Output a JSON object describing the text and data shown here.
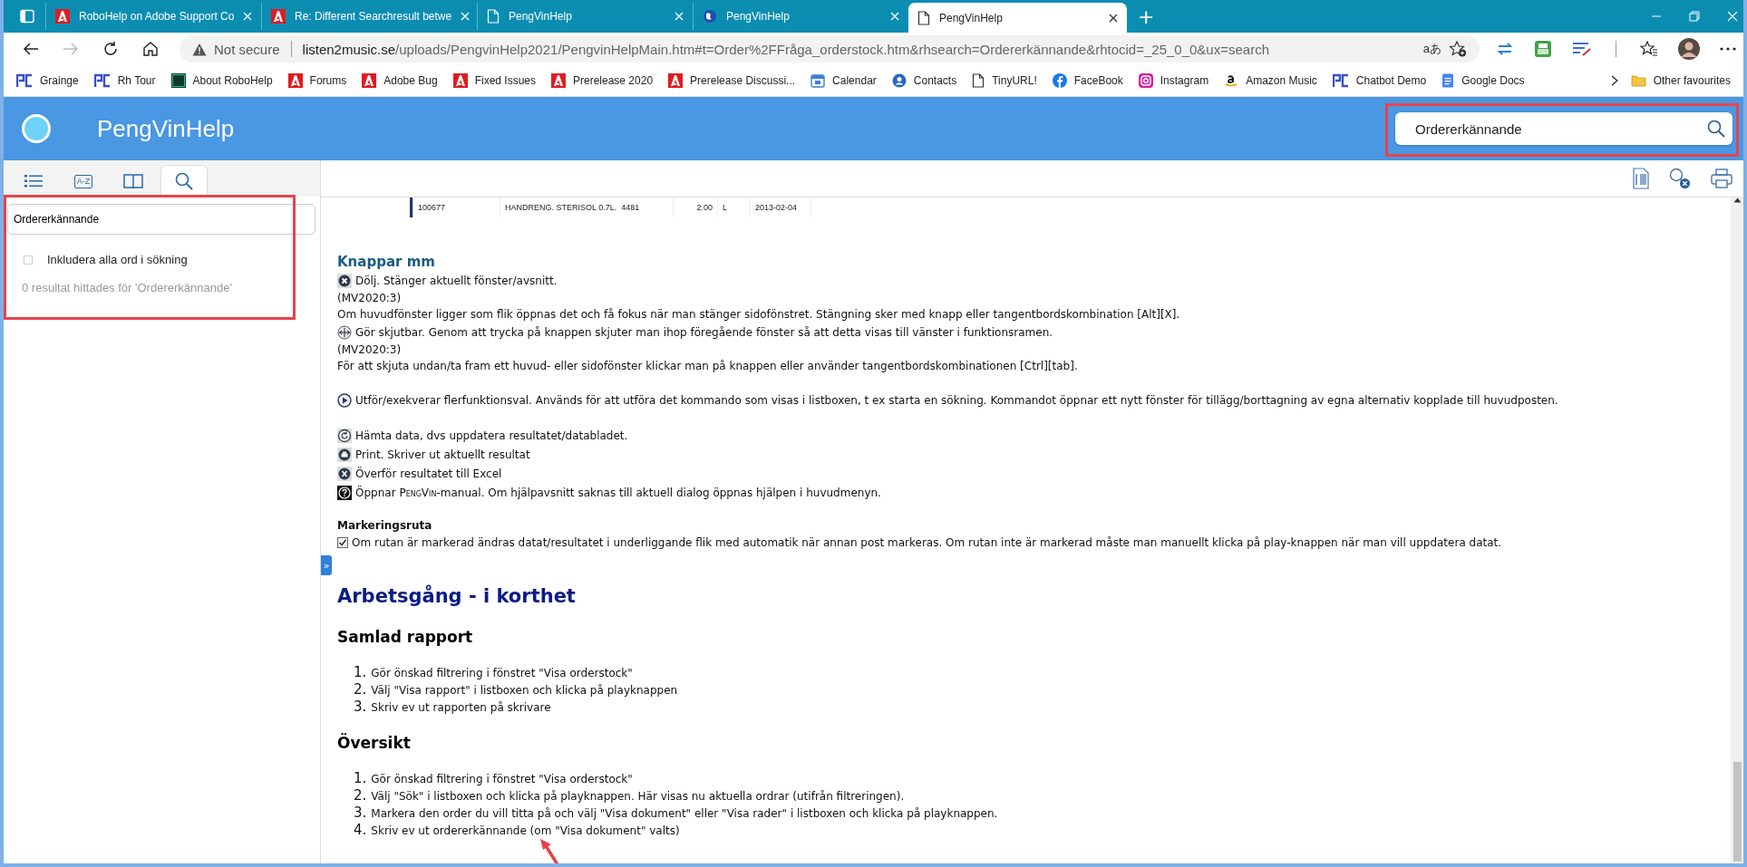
{
  "browser": {
    "tabs": [
      {
        "title": "RoboHelp on Adobe Support Co",
        "kind": "adobe",
        "selected": false
      },
      {
        "title": "Re: Different Searchresult betwe",
        "kind": "adobe",
        "selected": false
      },
      {
        "title": "PengVinHelp",
        "kind": "page",
        "selected": false
      },
      {
        "title": "PengVinHelp",
        "kind": "globe",
        "selected": false
      },
      {
        "title": "PengVinHelp",
        "kind": "page",
        "selected": true
      }
    ],
    "new_tab": "+",
    "address": {
      "security": "Not secure",
      "host": "listen2music.se",
      "path": "/uploads/PengvinHelp2021/PengvinHelpMain.htm#t=Order%2FFråga_orderstock.htm&rhsearch=Ordererkännande&rhtocid=_25_0_0&ux=search",
      "read_aloud": "aあ"
    },
    "bookmarks": [
      {
        "label": "Grainge",
        "kind": "pc"
      },
      {
        "label": "Rh Tour",
        "kind": "pc"
      },
      {
        "label": "About RoboHelp",
        "kind": "rh"
      },
      {
        "label": "Forums",
        "kind": "adobe"
      },
      {
        "label": "Adobe Bug",
        "kind": "adobe"
      },
      {
        "label": "Fixed Issues",
        "kind": "adobe"
      },
      {
        "label": "Prerelease 2020",
        "kind": "adobe"
      },
      {
        "label": "Prerelease Discussi...",
        "kind": "adobe"
      },
      {
        "label": "Calendar",
        "kind": "calendar"
      },
      {
        "label": "Contacts",
        "kind": "contacts"
      },
      {
        "label": "TinyURL!",
        "kind": "page"
      },
      {
        "label": "FaceBook",
        "kind": "facebook"
      },
      {
        "label": "Instagram",
        "kind": "instagram"
      },
      {
        "label": "Amazon Music",
        "kind": "amazon"
      },
      {
        "label": "Chatbot Demo",
        "kind": "pc"
      },
      {
        "label": "Google Docs",
        "kind": "docs"
      }
    ],
    "other_favourites": "Other favourites"
  },
  "header": {
    "title": "PengVinHelp",
    "search": {
      "value": "Ordererkännande",
      "highlighted": true
    }
  },
  "sidebar": {
    "tabs": [
      {
        "kind": "toc",
        "selected": false
      },
      {
        "kind": "index",
        "label": "A-Z",
        "selected": false
      },
      {
        "kind": "glossary",
        "selected": false
      },
      {
        "kind": "search",
        "selected": true
      }
    ],
    "search_panel": {
      "value": "Ordererkännande",
      "highlighted": true,
      "option": {
        "label": "Inkludera alla ord i sökning",
        "checked": false
      },
      "result": "0 resultat hittades för 'Ordererkännande'"
    }
  },
  "content": {
    "toggle": "»",
    "table": {
      "rows": [
        {
          "column_1": "100677",
          "column_2": "HANDRENG. STERISOL 0.7L.  4481",
          "column_3": "2.00",
          "column_4": "L",
          "column_5": "2013-02-04"
        }
      ]
    },
    "blocks": [
      {
        "kind": "h3",
        "text": "Knappar mm"
      },
      {
        "kind": "close_line",
        "text": "Dölj. Stänger aktuellt fönster/avsnitt."
      },
      {
        "kind": "line",
        "text": "(MV2020:3)"
      },
      {
        "kind": "line",
        "text": "Om huvudfönster ligger som flik öppnas det och få fokus när man stänger sidofönstret. Stängning sker med knapp eller tangentbordskombination [Alt][X]."
      },
      {
        "kind": "slide_line",
        "text": "Gör skjutbar. Genom att trycka på knappen skjuter man ihop föregående fönster så att detta visas till vänster i funktionsramen."
      },
      {
        "kind": "line",
        "text": "(MV2020:3)"
      },
      {
        "kind": "line",
        "text": "För att skjuta undan/ta fram ett huvud- eller sidofönster klickar man på knappen eller använder tangentbordskombinationen [Ctrl][tab]."
      },
      {
        "kind": "play_line",
        "space_before": true,
        "text": "Utför/exekverar flerfunktionsval. Används för att utföra det kommando som visas i listboxen, t ex starta en sökning. Kommandot öppnar ett nytt fönster för tillägg/borttagning av egna alternativ kopplade till huvudposten."
      },
      {
        "kind": "refresh_line",
        "space_before": true,
        "text": "Hämta data, dvs uppdatera resultatet/databladet."
      },
      {
        "kind": "print_line",
        "text": "Print. Skriver ut aktuellt resultat"
      },
      {
        "kind": "excel_line",
        "text": "Överför resultatet till Excel"
      },
      {
        "kind": "help_line",
        "segments": [
          {
            "text": "Öppnar "
          },
          {
            "text": "PengVin",
            "kind": "brand"
          },
          {
            "text": "-manual. Om hjälpavsnitt saknas till aktuell dialog öppnas hjälpen i huvudmenyn."
          }
        ]
      },
      {
        "kind": "label",
        "space_before": true,
        "text": "Markeringsruta"
      },
      {
        "kind": "checkbox_line",
        "text": "Om rutan är markerad ändras datat/resultatet i underliggande flik med automatik när annan post markeras. Om rutan inte är markerad måste man manuellt klicka på play-knappen när man vill uppdatera datat."
      },
      {
        "kind": "h1",
        "text": "Arbetsgång - i korthet"
      },
      {
        "kind": "h2",
        "text": "Samlad rapport"
      },
      {
        "kind": "list",
        "items": [
          {
            "number": "1.",
            "text": "Gör önskad filtrering i fönstret \"Visa orderstock\""
          },
          {
            "number": "2.",
            "text": "Välj \"Visa rapport\" i listboxen och klicka på playknappen"
          },
          {
            "number": "3.",
            "text": "Skriv ev ut rapporten på skrivare"
          }
        ]
      },
      {
        "kind": "h2",
        "text": "Översikt"
      },
      {
        "kind": "list",
        "items": [
          {
            "number": "1.",
            "text": "Gör önskad filtrering i fönstret \"Visa orderstock\""
          },
          {
            "number": "2.",
            "text": "Välj \"Sök\" i listboxen och klicka på playknappen. Här visas nu aktuella ordrar (utifrån filtreringen)."
          },
          {
            "number": "3.",
            "text": "Markera den order du vill titta på och välj \"Visa dokument\" eller \"Visa rader\" i listboxen och klicka på playknappen."
          },
          {
            "number": "4.",
            "text": "Skriv ev ut ordererkännande (om \"Visa dokument\" valts)",
            "arrow": true
          }
        ]
      }
    ]
  }
}
